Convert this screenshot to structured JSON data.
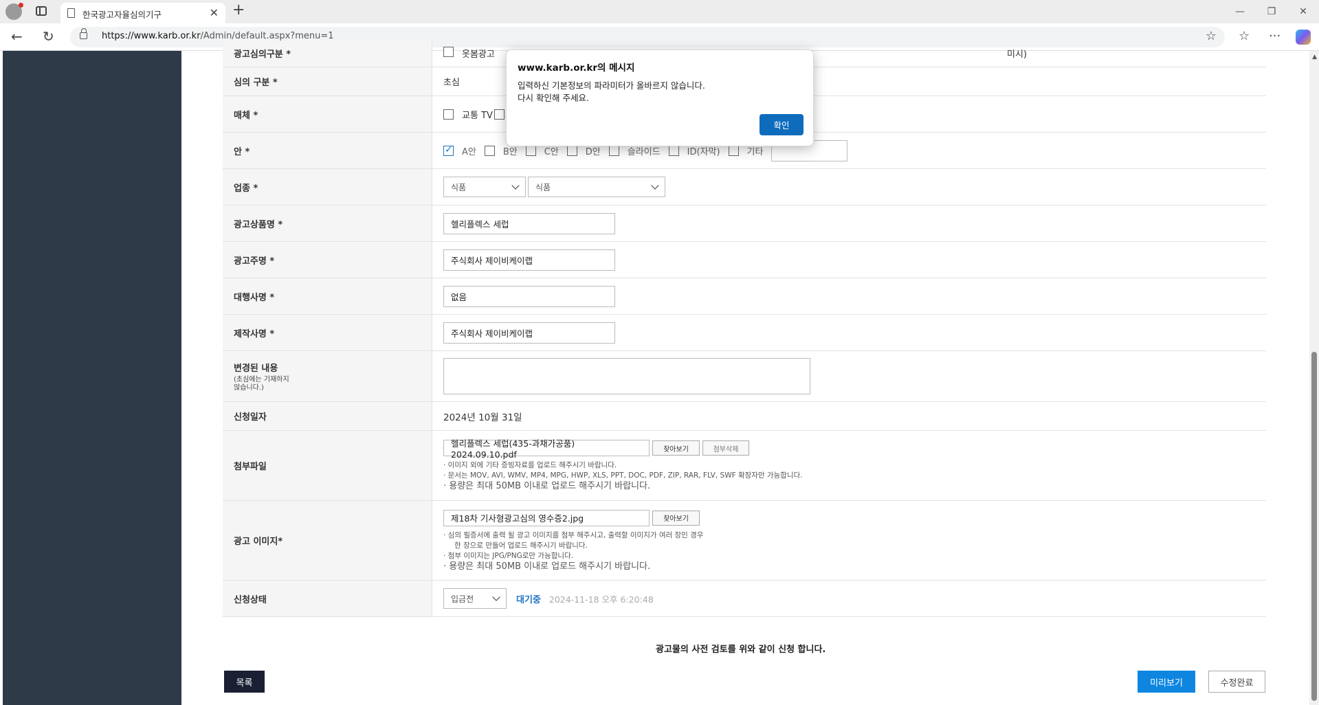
{
  "browser": {
    "tab_title": "한국광고자율심의기구",
    "url_domain": "https://www.karb.or.kr",
    "url_path": "/Admin/default.aspx?menu=1"
  },
  "form": {
    "row_category": {
      "label": "광고심의구분 *",
      "option1": "옷봄광고",
      "trailing": "미시)"
    },
    "row_review_type": {
      "label": "심의 구분 *",
      "value": "초심"
    },
    "row_media": {
      "label": "매체 *",
      "option1": "교통 TV"
    },
    "row_version": {
      "label": "안 *",
      "options": [
        {
          "label": "A안",
          "checked": true
        },
        {
          "label": "B안",
          "checked": false
        },
        {
          "label": "C안",
          "checked": false
        },
        {
          "label": "D안",
          "checked": false
        },
        {
          "label": "슬라이드",
          "checked": false
        },
        {
          "label": "ID(자막)",
          "checked": false
        },
        {
          "label": "기타",
          "checked": false
        }
      ]
    },
    "row_industry": {
      "label": "업종 *",
      "select1": "식품",
      "select2": "식품"
    },
    "row_product": {
      "label": "광고상품명 *",
      "value": "헬리플렉스 세럽"
    },
    "row_advertiser": {
      "label": "광고주명 *",
      "value": "주식회사 제이비케이랩"
    },
    "row_agency": {
      "label": "대행사명 *",
      "value": "없음"
    },
    "row_producer": {
      "label": "제작사명 *",
      "value": "주식회사 제이비케이랩"
    },
    "row_changes": {
      "label": "변경된 내용",
      "sub1": "(초심에는 기재하지",
      "sub2": "않습니다.)",
      "value": ""
    },
    "row_apply_date": {
      "label": "신청일자",
      "value": "2024년 10월 31일"
    },
    "row_attachment": {
      "label": "첨부파일",
      "file": "헬리플렉스 세럽(435-과채가공품) 2024.09.10.pdf",
      "browse": "찾아보기",
      "delete": "첨부삭제",
      "note1": "· 이미지 외에 기타 증빙자료를 업로드 해주시기 바랍니다.",
      "note2": "· 문서는 MOV, AVI, WMV, MP4, MPG, HWP, XLS, PPT, DOC, PDF, ZIP, RAR, FLV, SWF 확장자만 가능합니다.",
      "note3": "· 용량은 최대 50MB 이내로 업로드 해주시기 바랍니다."
    },
    "row_ad_image": {
      "label": "광고 이미지*",
      "file": "제18차 기사형광고심의 영수증2.jpg",
      "browse": "찾아보기",
      "note1": "· 심의 필증서에 출력 될 광고 이미지를 첨부 해주시고, 출력할 이미지가 여러 장인 경우",
      "note2": "한 장으로 만들어 업로드 해주시기 바랍니다.",
      "note3": "· 첨부 이미지는 JPG/PNG로만 가능합니다.",
      "note4": "· 용량은 최대 50MB 이내로 업로드 해주시기 바랍니다."
    },
    "row_status": {
      "label": "신청상태",
      "select": "입금전",
      "status": "대기중",
      "timestamp": "2024-11-18 오후 6:20:48"
    }
  },
  "consent_text": "광고물의 사전 검토를 위와 같이 신청 합니다.",
  "buttons": {
    "list": "목록",
    "preview": "미리보기",
    "done": "수정완료"
  },
  "dialog": {
    "title": "www.karb.or.kr의 메시지",
    "line1": "입력하신 기본정보의 파라미터가 올바르지 않습니다.",
    "line2": "다시 확인해 주세요.",
    "ok": "확인"
  },
  "colors": {
    "sidebar": "#2e3a48",
    "accent": "#0e86e0",
    "dialog_button": "#0f6cbd",
    "status": "#1e73c5"
  }
}
